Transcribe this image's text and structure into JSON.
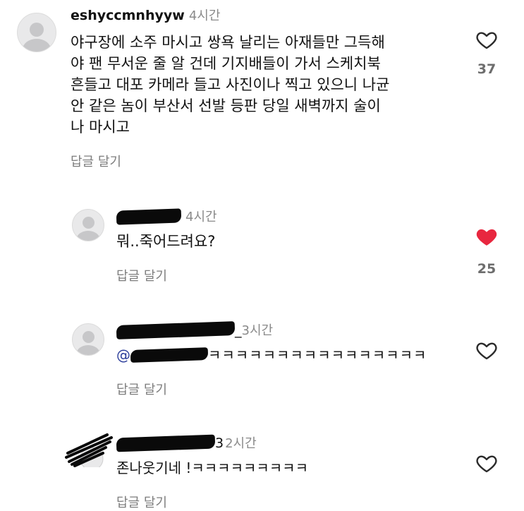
{
  "comments": [
    {
      "username": "eshyccmnhyyw",
      "time": "4시간",
      "lines": [
        "야구장에 소주 마시고 쌍욕 날리는 아재들만 그득해",
        "야 팬 무서운 줄 알 건데 기지배들이 가서 스케치북",
        "흔들고 대포 카메라 들고 사진이나 찍고 있으니 나균",
        "안 같은 놈이 부산서 선발 등판 당일 새벽까지 술이",
        "나 마시고"
      ],
      "reply_label": "답글 달기",
      "like_icon": "heart-outline-icon",
      "liked": false,
      "like_count": "37"
    },
    {
      "username_partial": "",
      "time": "4시간",
      "text": "뭐..죽어드려요?",
      "reply_label": "답글 달기",
      "like_icon": "heart-filled-icon",
      "liked": true,
      "like_color": "#e8273f",
      "like_count": "25"
    },
    {
      "username_partial": "_",
      "time": "3시간",
      "mention_prefix": "@",
      "text": "ㅋㅋㅋㅋㅋㅋㅋㅋㅋㅋㅋㅋㅋㅋㅋㅋ",
      "reply_label": "답글 달기",
      "like_icon": "heart-outline-icon",
      "liked": false
    },
    {
      "username_partial": "3",
      "time": "2시간",
      "text": "존나웃기네 !ㅋㅋㅋㅋㅋㅋㅋㅋㅋ",
      "reply_label": "답글 달기",
      "like_icon": "heart-outline-icon",
      "liked": false
    }
  ]
}
